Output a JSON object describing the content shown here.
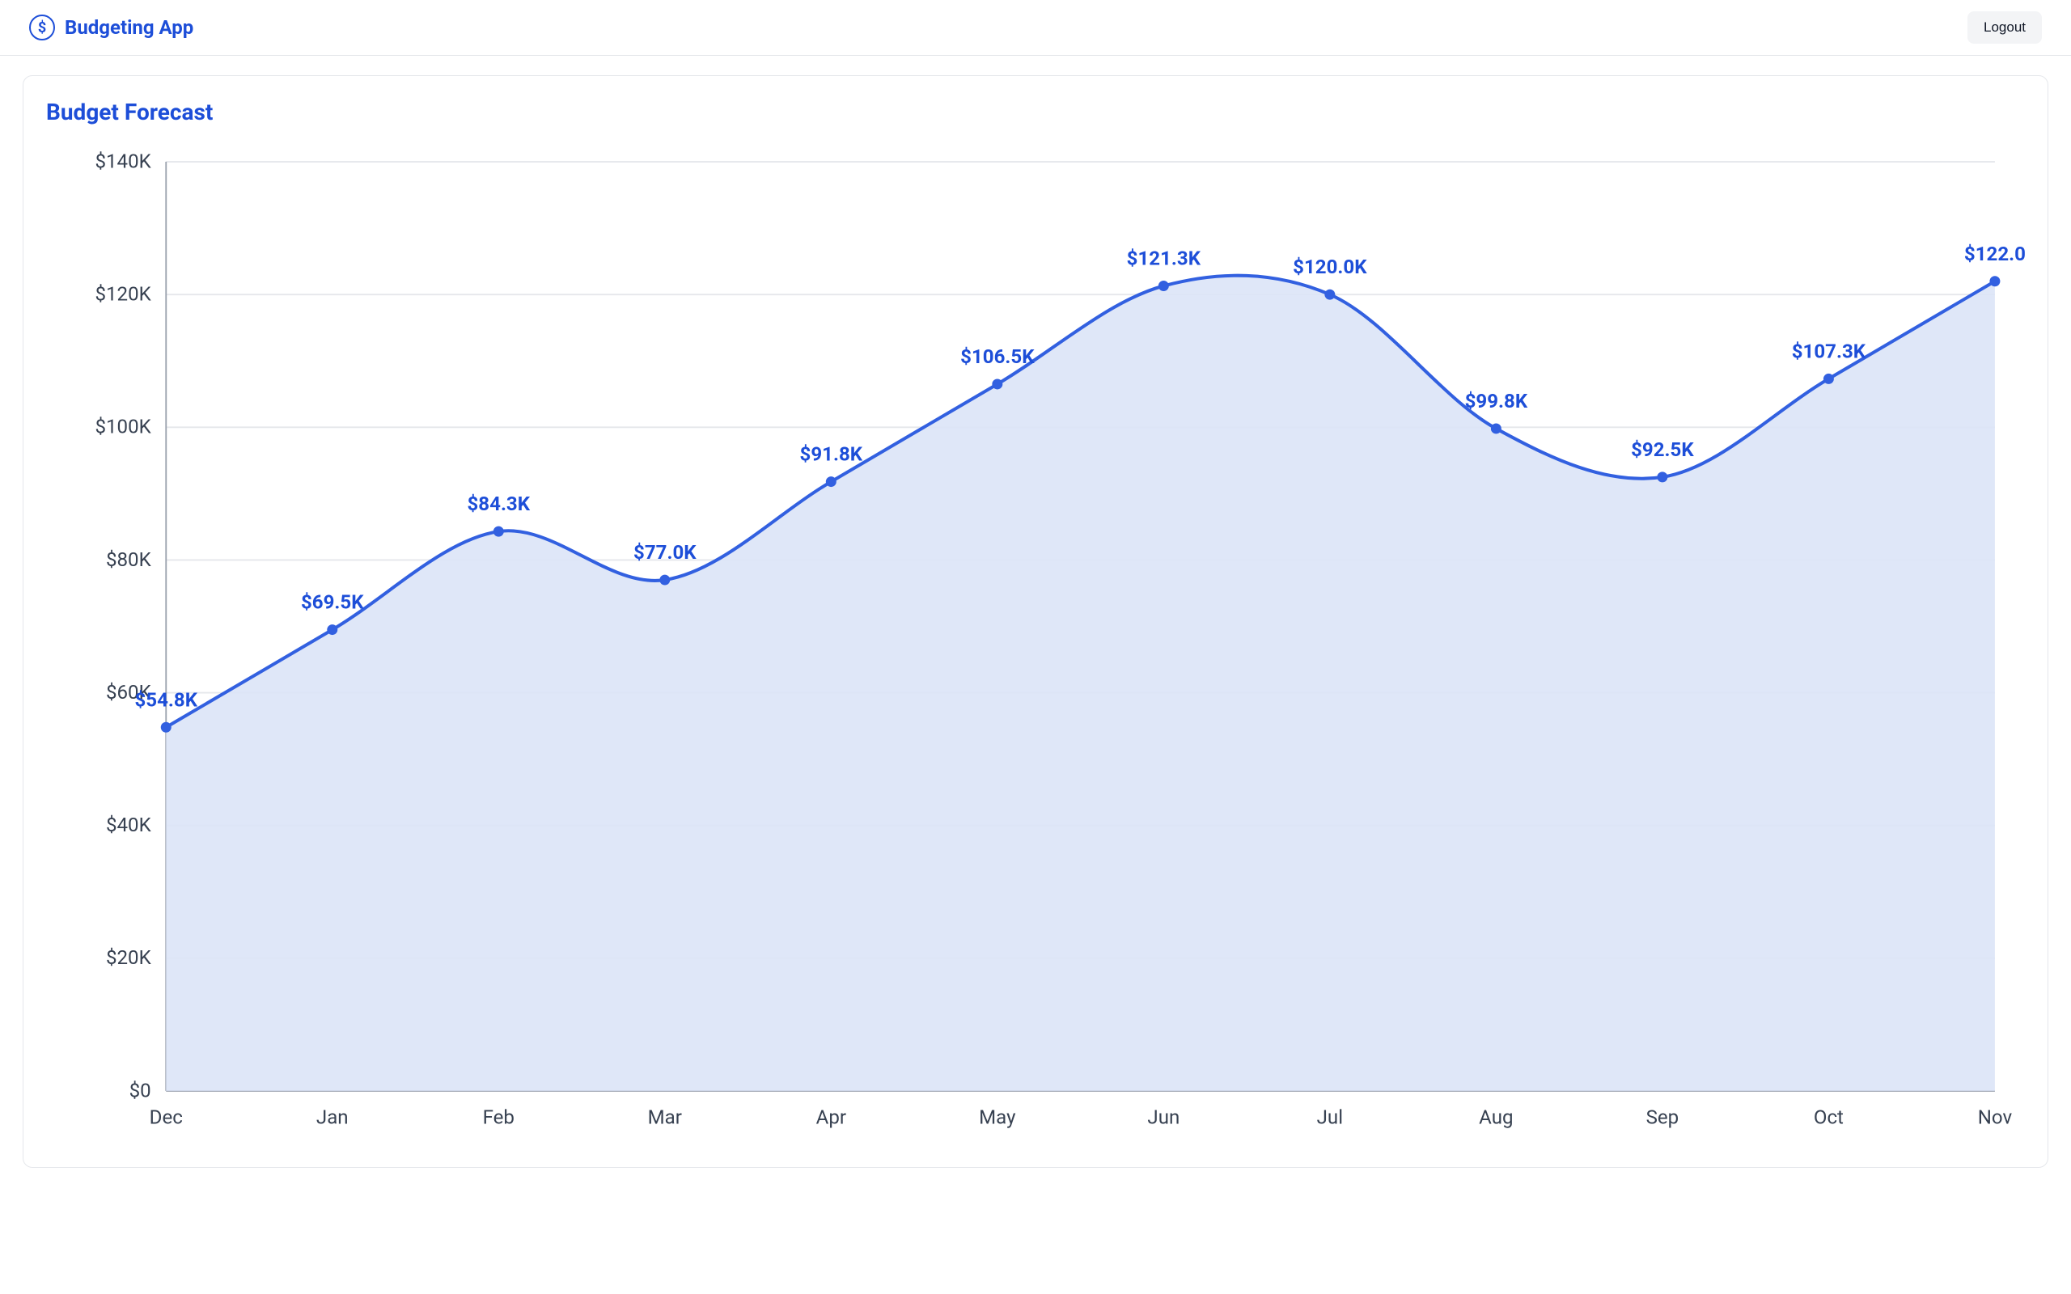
{
  "header": {
    "app_title": "Budgeting App",
    "logout_label": "Logout"
  },
  "card": {
    "title": "Budget Forecast"
  },
  "colors": {
    "brand": "#1d4ed8",
    "line": "#3260e0",
    "area": "#dbe4f7",
    "grid": "#e5e7eb",
    "axis": "#9ca3af"
  },
  "chart_data": {
    "type": "area",
    "title": "Budget Forecast",
    "xlabel": "",
    "ylabel": "",
    "ylim": [
      0,
      140
    ],
    "y_ticks": [
      0,
      20,
      40,
      60,
      80,
      100,
      120,
      140
    ],
    "y_tick_labels": [
      "$0",
      "$20K",
      "$40K",
      "$60K",
      "$80K",
      "$100K",
      "$120K",
      "$140K"
    ],
    "categories": [
      "Dec",
      "Jan",
      "Feb",
      "Mar",
      "Apr",
      "May",
      "Jun",
      "Jul",
      "Aug",
      "Sep",
      "Oct",
      "Nov"
    ],
    "series": [
      {
        "name": "Forecast",
        "values": [
          54.8,
          69.5,
          84.3,
          77.0,
          91.8,
          106.5,
          121.3,
          120.0,
          99.8,
          92.5,
          107.3,
          122.0
        ],
        "point_labels": [
          "$54.8K",
          "$69.5K",
          "$84.3K",
          "$77.0K",
          "$91.8K",
          "$106.5K",
          "$121.3K",
          "$120.0K",
          "$99.8K",
          "$92.5K",
          "$107.3K",
          "$122.0"
        ]
      }
    ]
  }
}
